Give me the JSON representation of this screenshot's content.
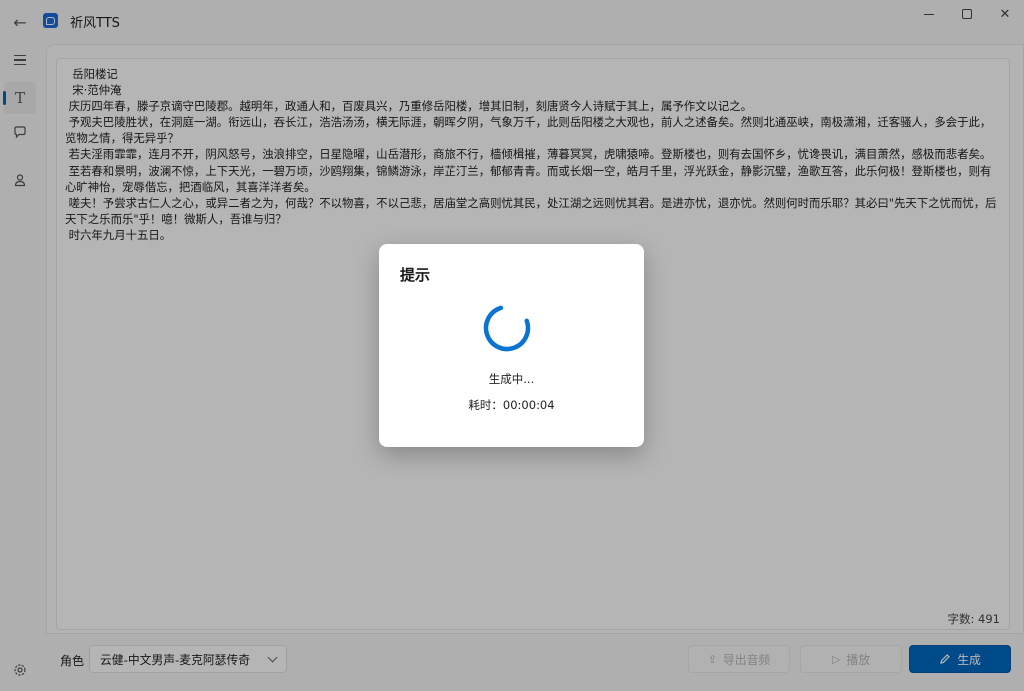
{
  "app": {
    "title": "祈风TTS"
  },
  "nav": {
    "items": [
      "menu-icon",
      "text-icon",
      "chat-icon",
      "user-icon",
      "settings-icon"
    ],
    "active_index": 1
  },
  "editor": {
    "lines": [
      "  岳阳楼记",
      "  宋·范仲淹",
      " 庆历四年春，滕子京谪守巴陵郡。越明年，政通人和，百废具兴，乃重修岳阳楼，增其旧制，刻唐贤今人诗赋于其上，属予作文以记之。",
      " 予观夫巴陵胜状，在洞庭一湖。衔远山，吞长江，浩浩汤汤，横无际涯，朝晖夕阴，气象万千，此则岳阳楼之大观也，前人之述备矣。然则北通巫峡，南极潇湘，迁客骚人，多会于此，览物之情，得无异乎？",
      " 若夫淫雨霏霏，连月不开，阴风怒号，浊浪排空，日星隐曜，山岳潜形，商旅不行，樯倾楫摧，薄暮冥冥，虎啸猿啼。登斯楼也，则有去国怀乡，忧谗畏讥，满目萧然，感极而悲者矣。",
      " 至若春和景明，波澜不惊，上下天光，一碧万顷，沙鸥翔集，锦鳞游泳，岸芷汀兰，郁郁青青。而或长烟一空，皓月千里，浮光跃金，静影沉璧，渔歌互答，此乐何极！登斯楼也，则有心旷神怡，宠辱偕忘，把酒临风，其喜洋洋者矣。",
      " 嗟夫！予尝求古仁人之心，或异二者之为，何哉？不以物喜，不以己悲，居庙堂之高则忧其民，处江湖之远则忧其君。是进亦忧，退亦忧。然则何时而乐耶？其必曰\"先天下之忧而忧，后天下之乐而乐\"乎！噫！微斯人，吾谁与归？",
      " 时六年九月十五日。"
    ],
    "char_count": "字数: 491"
  },
  "bottom": {
    "role_label": "角色",
    "role_value": "云健-中文男声-麦克阿瑟传奇",
    "export_label": "导出音频",
    "play_label": "播放",
    "generate_label": "生成"
  },
  "dialog": {
    "title": "提示",
    "status": "生成中...",
    "elapsed": "耗时：00:00:04"
  },
  "colors": {
    "accent": "#0067c0",
    "spinner": "#0a74d0"
  }
}
